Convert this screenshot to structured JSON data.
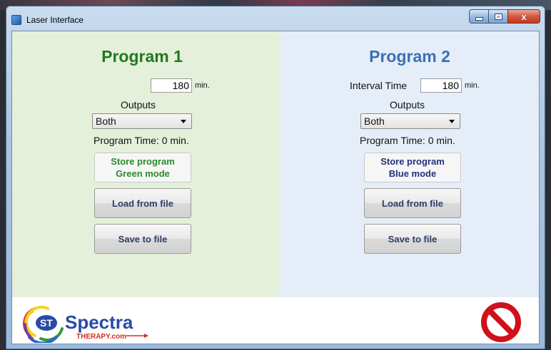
{
  "window": {
    "title": "Laser Interface",
    "close_glyph": "x"
  },
  "program1": {
    "title": "Program 1",
    "interval_value": "180",
    "interval_unit": "min.",
    "outputs_label": "Outputs",
    "outputs_selected": "Both",
    "program_time": "Program Time: 0 min.",
    "store_line1": "Store program",
    "store_line2": "Green mode",
    "load_label": "Load from file",
    "save_label": "Save to file",
    "accent_color": "#1f7a1f",
    "panel_color": "#e4f0da"
  },
  "program2": {
    "title": "Program 2",
    "interval_label": "Interval Time",
    "interval_value": "180",
    "interval_unit": "min.",
    "outputs_label": "Outputs",
    "outputs_selected": "Both",
    "program_time": "Program Time: 0 min.",
    "store_line1": "Store program",
    "store_line2": "Blue mode",
    "load_label": "Load from file",
    "save_label": "Save to file",
    "accent_color": "#3d6fb6",
    "panel_color": "#e5eef8"
  },
  "footer": {
    "logo_st": "ST",
    "logo_brand": "Spectra",
    "logo_sub": "THERAPY.com",
    "stop_icon": "prohibited-icon",
    "stop_color": "#d0101a"
  }
}
